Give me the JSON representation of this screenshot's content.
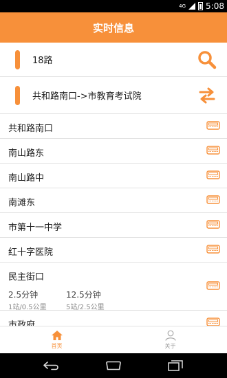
{
  "statusbar": {
    "network": "4G",
    "time": "5:08"
  },
  "header": {
    "title": "实时信息"
  },
  "search": {
    "route": "18路",
    "icon": "search-icon"
  },
  "direction": {
    "text": "共和路南口->市教育考试院",
    "icon": "swap-icon"
  },
  "stops": [
    {
      "name": "共和路南口"
    },
    {
      "name": "南山路东"
    },
    {
      "name": "南山路中"
    },
    {
      "name": "南滩东"
    },
    {
      "name": "市第十一中学"
    },
    {
      "name": "红十字医院"
    },
    {
      "name": "民主街口",
      "eta1": "2.5分钟",
      "eta2": "12.5分钟",
      "dist1": "1站/0.5公里",
      "dist2": "5站/2.5公里"
    },
    {
      "name": "市政府"
    }
  ],
  "tabs": {
    "home": "首页",
    "about": "关于"
  },
  "colors": {
    "accent": "#f7903a"
  }
}
